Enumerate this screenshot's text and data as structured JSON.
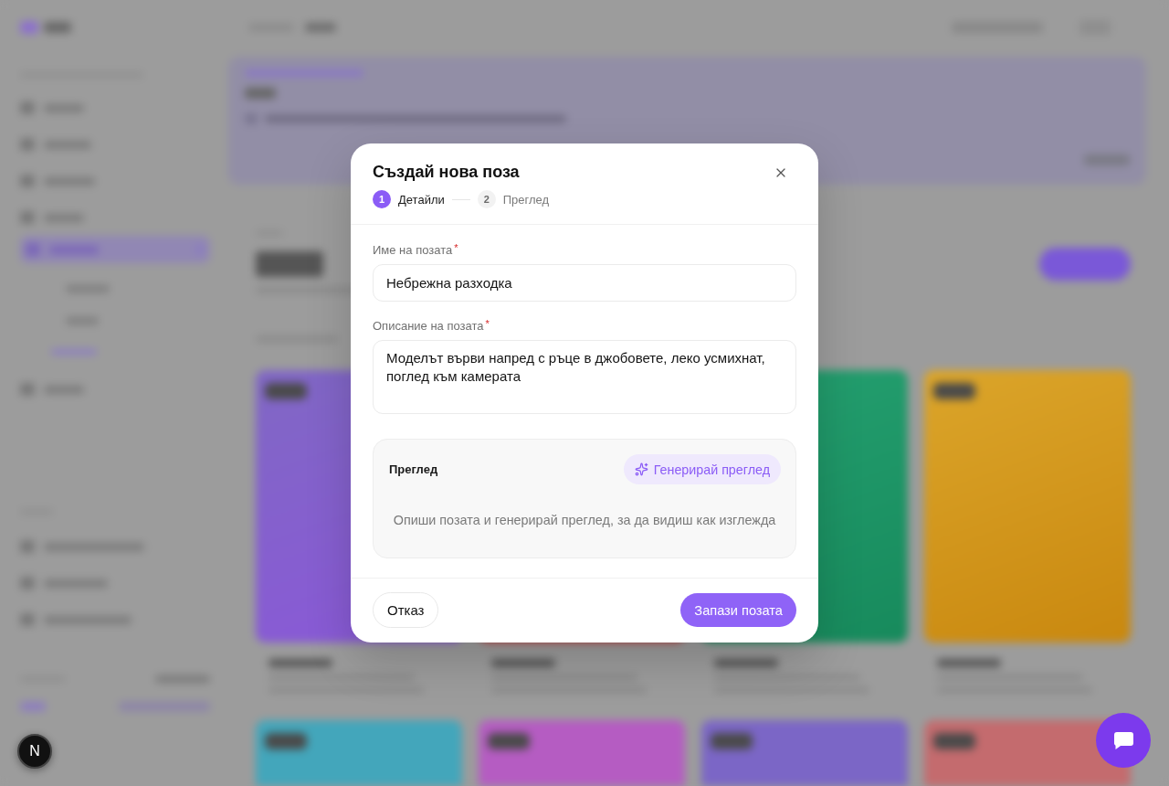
{
  "dialog": {
    "title": "Създай нова поза",
    "steps": [
      {
        "number": "1",
        "label": "Детайли",
        "selected": true
      },
      {
        "number": "2",
        "label": "Преглед",
        "selected": false
      }
    ],
    "fields": [
      {
        "kind": "input",
        "label": "Име на позата",
        "required_mark": "*",
        "value": "Небрежна разходка"
      },
      {
        "kind": "textarea",
        "label": "Описание на позата",
        "required_mark": "*",
        "value": "Моделът върви напред с ръце в джобовете, леко усмихнат, поглед към камерата"
      }
    ],
    "preview": {
      "title": "Преглед",
      "generate_button": "Генерирай преглед",
      "empty_text": "Опиши позата и генерирай преглед, за да видиш как изглежда"
    },
    "buttons": [
      {
        "kind": "secondary",
        "label": "Отказ"
      },
      {
        "kind": "primary",
        "label": "Запази позата"
      }
    ]
  },
  "dev_badge": {
    "label": "N"
  }
}
